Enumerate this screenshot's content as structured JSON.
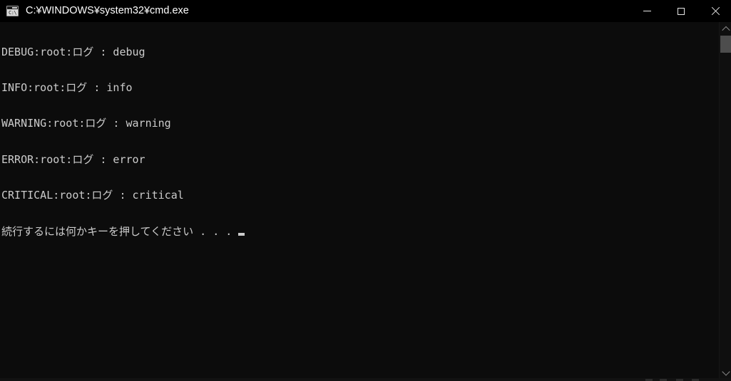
{
  "window": {
    "title": "C:¥WINDOWS¥system32¥cmd.exe",
    "icon": "cmd-console-icon",
    "icon_prompt_glyph": "C:\\",
    "background_color": "#0c0c0c",
    "titlebar_color": "#000000",
    "text_color": "#cccccc"
  },
  "window_controls": {
    "minimize_label": "—",
    "maximize_label": "□",
    "close_label": "✕",
    "minimize_name": "minimize-icon",
    "maximize_name": "maximize-icon",
    "close_name": "close-icon"
  },
  "console": {
    "lines": [
      "DEBUG:root:ログ : debug",
      "INFO:root:ログ : info",
      "WARNING:root:ログ : warning",
      "ERROR:root:ログ : error",
      "CRITICAL:root:ログ : critical"
    ],
    "prompt": "続行するには何かキーを押してください . . .",
    "cursor": "block-cursor"
  },
  "scrollbar": {
    "up_arrow": "▲",
    "down_arrow": "▼",
    "thumb_color": "#4d4d4d",
    "track_color": "#0f0f0f"
  }
}
